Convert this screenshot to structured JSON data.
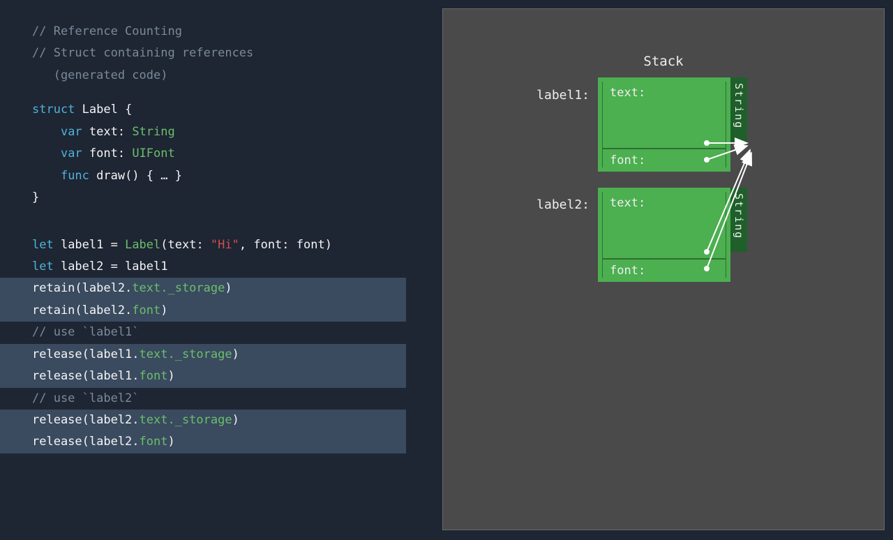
{
  "code": {
    "comment1": "// Reference Counting",
    "comment2a": "// Struct containing references",
    "comment2b": "   (generated code)",
    "struct_kw": "struct",
    "struct_name": " Label {",
    "var_kw": "var",
    "text_name": " text: ",
    "string_type": "String",
    "font_name": " font: ",
    "uifont_type": "UIFont",
    "func_kw": "func",
    "draw_sig": " draw() { … }",
    "brace_close": "}",
    "let_kw": "let",
    "let1_a": " label1 = ",
    "label_ctor": "Label",
    "let1_b": "(text: ",
    "hi_str": "\"Hi\"",
    "let1_c": ", font: font)",
    "let2": " label2 = label1",
    "retain1_a": "retain(label2.",
    "retain1_b": "text._storage",
    "retain1_c": ")",
    "retain2_a": "retain(label2.",
    "retain2_b": "font",
    "retain2_c": ")",
    "use1": "// use `label1`",
    "release1_a": "release(label1.",
    "release1_b": "text._storage",
    "release1_c": ")",
    "release2_a": "release(label1.",
    "release2_b": "font",
    "release2_c": ")",
    "use2": "// use `label2`",
    "release3_a": "release(label2.",
    "release3_b": "text._storage",
    "release3_c": ")",
    "release4_a": "release(label2.",
    "release4_b": "font",
    "release4_c": ")"
  },
  "diagram": {
    "title": "Stack",
    "label1": "label1:",
    "label2": "label2:",
    "text_field": "text:",
    "font_field": "font:",
    "string_tag": "String"
  }
}
